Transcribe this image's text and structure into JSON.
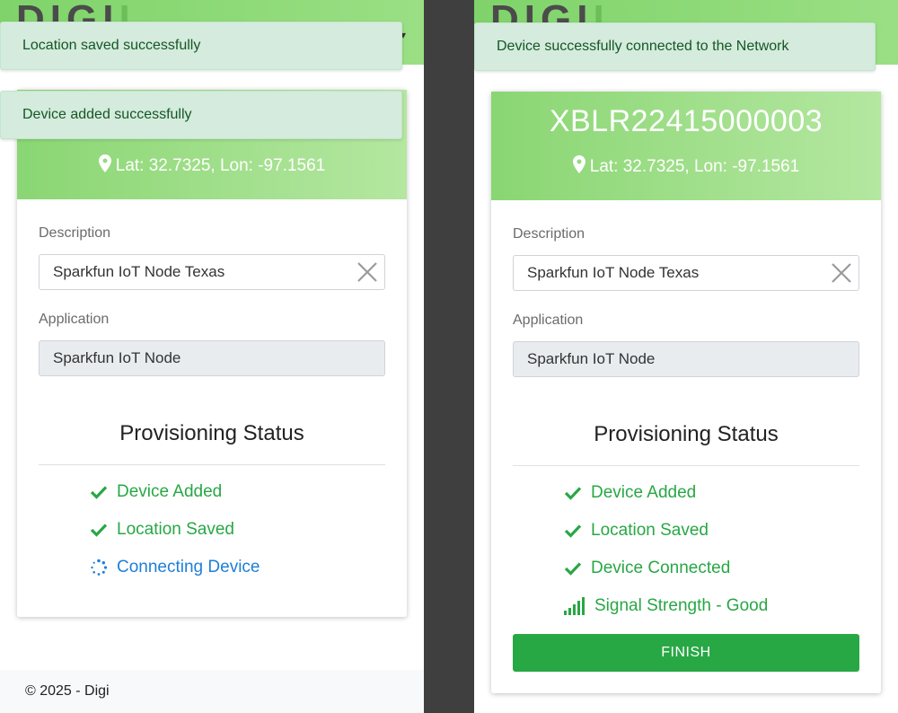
{
  "brand": {
    "logo_text": "DIGI",
    "logo_tail": "I",
    "menu_caret": "▾"
  },
  "left": {
    "toasts": [
      "Location saved successfully",
      "Device added successfully"
    ],
    "coords": "Lat: 32.7325, Lon: -97.1561",
    "description": {
      "label": "Description",
      "value": "Sparkfun IoT Node Texas"
    },
    "application": {
      "label": "Application",
      "value": "Sparkfun IoT Node"
    },
    "provisioning_title": "Provisioning Status",
    "status": [
      {
        "label": "Device Added",
        "icon": "check-icon",
        "state": "done"
      },
      {
        "label": "Location Saved",
        "icon": "check-icon",
        "state": "done"
      },
      {
        "label": "Connecting Device",
        "icon": "spinner-icon",
        "state": "in-progress"
      }
    ],
    "footer": "© 2025 - Digi"
  },
  "right": {
    "toasts": [
      "Device successfully connected to the Network"
    ],
    "device_id": "XBLR22415000003",
    "coords": "Lat: 32.7325, Lon: -97.1561",
    "description": {
      "label": "Description",
      "value": "Sparkfun IoT Node Texas"
    },
    "application": {
      "label": "Application",
      "value": "Sparkfun IoT Node"
    },
    "provisioning_title": "Provisioning Status",
    "status": [
      {
        "label": "Device Added",
        "icon": "check-icon",
        "state": "done"
      },
      {
        "label": "Location Saved",
        "icon": "check-icon",
        "state": "done"
      },
      {
        "label": "Device Connected",
        "icon": "check-icon",
        "state": "done"
      },
      {
        "label": "Signal Strength - Good",
        "icon": "signal-bars-icon",
        "state": "good"
      }
    ],
    "finish_label": "FINISH"
  },
  "colors": {
    "success": "#28a745",
    "progress": "#1e7fd8",
    "header_green": "#8ad673",
    "toast_bg": "#d4ebdd",
    "toast_text": "#155724"
  }
}
